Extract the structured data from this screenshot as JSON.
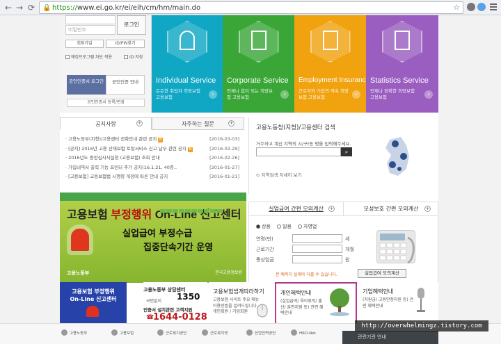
{
  "browser": {
    "url_scheme": "https://",
    "url_host": "www.ei.go.kr",
    "url_path": "/ei/eih/cm/hm/main.do"
  },
  "login": {
    "id_placeholder": "",
    "pw_placeholder": "비밀번호",
    "login_button": "로그인",
    "join_button": "회원가입",
    "find_button": "ID/PW찾기",
    "opt_security": "해킹프로그램 차단 적용",
    "opt_save_id": "ID 저장",
    "cert_login": "공인인증서 로그인",
    "cert_guide": "공인인증 안내",
    "cert_register": "공인인증서 등록/변경"
  },
  "services": [
    {
      "title": "Individual Service",
      "desc": "든든한 취업자 희망보험 고용보험",
      "color": "#0fa7c4"
    },
    {
      "title": "Corporate Service",
      "desc": "언제나 힘이 되는 희망보험 고용보험",
      "color": "#3aa637"
    },
    {
      "title": "Employment Insurance",
      "desc": "근로자와 기업의 약속 희망보험 고용보험",
      "color": "#f1a20f"
    },
    {
      "title": "Statistics Service",
      "desc": "언제나 정확한 희망보험 고용보험",
      "color": "#9a5dc0"
    }
  ],
  "notices": {
    "tab_notice": "공지사항",
    "tab_faq": "자주하는 질문",
    "items": [
      {
        "title": "고용노동부(지청)/고용센터 전화안내 관련 공지",
        "date": "[2016-03-03]",
        "new": "N"
      },
      {
        "title": "[공지] 2016년 고용 산재보험 토탈서비스 신고 납부 관련 공지",
        "date": "[2016-02-29]",
        "new": "N"
      },
      {
        "title": "2016년도 중앙심사사실청 (고용보험) 조회 안내",
        "date": "[2016-02-26]",
        "new": ""
      },
      {
        "title": "가입내역서 출력 기능 프린터 추가 공지(16.1.21, 40종..",
        "date": "[2016-01-27]",
        "new": ""
      },
      {
        "title": "[고용보험] 고용보험법 시행령 개정에 따른 안내 공지",
        "date": "[2016-01-21]",
        "new": ""
      }
    ]
  },
  "office": {
    "title": "고용노동청(지청)/고용센터 검색",
    "desc": "거주하고 계신 지역의 시/구/동 명을 입력해주세요.",
    "link": "지역검색 자세히 보기"
  },
  "banner": {
    "line1_a": "고용보험",
    "line1_b": "부정행위",
    "line1_c": "On-Line 신고센터",
    "line2": "실업급여 부정수급",
    "line3": "집중단속기간 운영",
    "logo": "고용노동부",
    "logo2": "한국고용정보원"
  },
  "calc": {
    "tab_unemp": "실업급여 간편 모의계산",
    "tab_mat": "모성보호 간편 모의계산",
    "radios": [
      "상용",
      "일용",
      "자영업"
    ],
    "rows": [
      {
        "label": "연령(만)",
        "unit": "세"
      },
      {
        "label": "근로기간",
        "unit": "개월"
      },
      {
        "label": "통상임금",
        "unit": "원"
      }
    ],
    "note": "본 예측치 실제와 다를 수 있습니다.",
    "button": "실업급여 모의계산"
  },
  "bottom": {
    "blue_1": "고용보험 부정행위",
    "blue_2": "On-Line 신고센터",
    "contact_label": "고용노동부 상담센터",
    "contact_num": "1350",
    "contact_sub": "국번없이",
    "contact_label2": "인증서 설치관련 고객지원",
    "contact_num2": "1644-0128",
    "card1_title": "고용보험법개따라하기",
    "card1_desc": "고용보험 사이트 주요 메뉴 이용방법을 알려드립니다. 개인회원 / 기업회원",
    "card2_title": "개인혜택안내",
    "card2_desc": "(실업급여/ 육아휴직/ 출산/ 훈련지원 등) 관련 혜택안내",
    "card3_title": "기업혜택안내",
    "card3_desc": "(지원금/ 고용안정지원 등) 관련 혜택안내"
  },
  "footer": {
    "logos": [
      "고용노동부",
      "고용보험",
      "근로복지공단",
      "근로복지넷",
      "산업인력공단",
      "HRD-Net"
    ],
    "button": "관련기관 안내",
    "watermark": "http://overwhelmingz.tistory.com"
  }
}
